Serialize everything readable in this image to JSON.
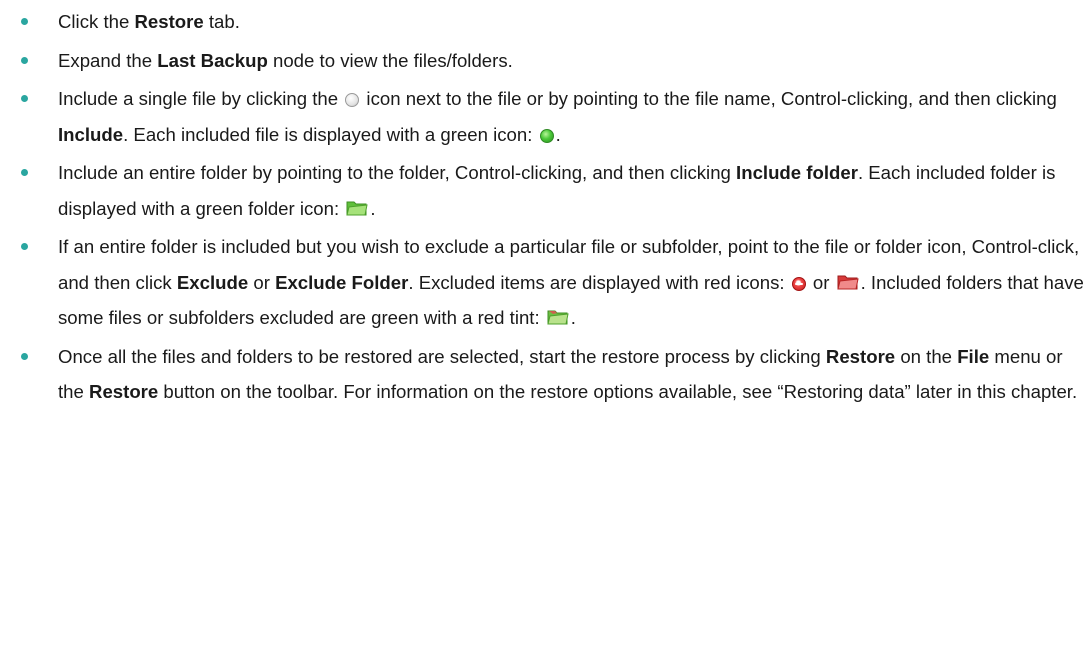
{
  "colors": {
    "bullet": "#2aa6a0",
    "text": "#1a1a1a",
    "include_green": "#4cc93a",
    "exclude_red": "#d42020"
  },
  "icons": {
    "unselected": "unselected-radio-icon",
    "included_file": "green-radio-icon",
    "included_folder": "green-folder-icon",
    "excluded_file": "red-radio-icon",
    "excluded_folder": "red-folder-icon",
    "partial_folder": "green-red-tint-folder-icon"
  },
  "steps": [
    {
      "t1": "Click the ",
      "b1": "Restore",
      "t2": " tab."
    },
    {
      "t1": "Expand the ",
      "b1": "Last Backup",
      "t2": " node to view the files/folders."
    },
    {
      "t1": "Include a single file by clicking the ",
      "t2": " icon next to the file or by pointing to the file name, Control-clicking, and then clicking ",
      "b1": "Include",
      "t3": ".  Each included file is displayed with a green icon: ",
      "t4": "."
    },
    {
      "t1": "Include an entire folder by pointing to the folder, Control-clicking, and then clicking ",
      "b1": "Include folder",
      "t2": ".  Each included folder is displayed with a green folder icon: ",
      "t3": "."
    },
    {
      "t1": "If an entire folder is included but you wish to exclude a particular file or subfolder, point to the file or folder icon, Control-click, and then click ",
      "b1": "Exclude",
      "t2": " or ",
      "b2": "Exclude Folder",
      "t3": ".  Excluded items are displayed with red icons: ",
      "t4": " or ",
      "t5": ". Included folders that have some files or subfolders excluded are green with a red tint: ",
      "t6": "."
    },
    {
      "t1": "Once all the files and folders to be restored are selected, start the restore process by clicking ",
      "b1": "Restore",
      "t2": " on the ",
      "b2": "File",
      "t3": " menu or the ",
      "b3": "Restore",
      "t4": " button on the toolbar. For information on the restore options available, see “Restoring data” later in this chapter."
    }
  ]
}
